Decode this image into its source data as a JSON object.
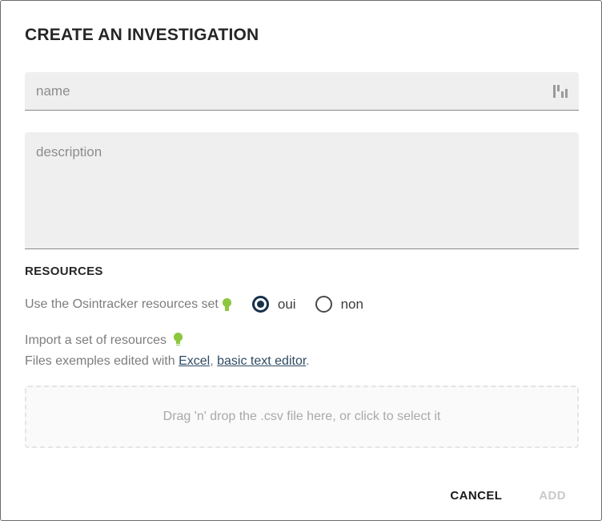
{
  "dialog": {
    "title": "CREATE AN INVESTIGATION"
  },
  "name_field": {
    "placeholder": "name",
    "value": "",
    "icon": "bar-glyph-icon"
  },
  "description_field": {
    "placeholder": "description",
    "value": ""
  },
  "resources": {
    "heading": "RESOURCES",
    "use_set": {
      "label": "Use the Osintracker resources set",
      "hint_icon": "lightbulb-icon",
      "options": [
        {
          "label": "oui",
          "selected": true
        },
        {
          "label": "non",
          "selected": false
        }
      ]
    },
    "import": {
      "label": "Import a set of resources",
      "hint_icon": "lightbulb-icon",
      "examples_prefix": "Files exemples edited with ",
      "link_excel": "Excel",
      "examples_separator": ", ",
      "link_text_editor": "basic text editor",
      "examples_suffix": "."
    },
    "dropzone": {
      "text": "Drag 'n' drop the .csv file here, or click to select it"
    }
  },
  "footer": {
    "cancel_label": "CANCEL",
    "add_label": "ADD"
  },
  "colors": {
    "accent_green": "#8dc63f",
    "radio_selected": "#16314a",
    "link": "#2f4a63",
    "field_background": "#efefef",
    "muted_text": "#7d7d7d"
  }
}
